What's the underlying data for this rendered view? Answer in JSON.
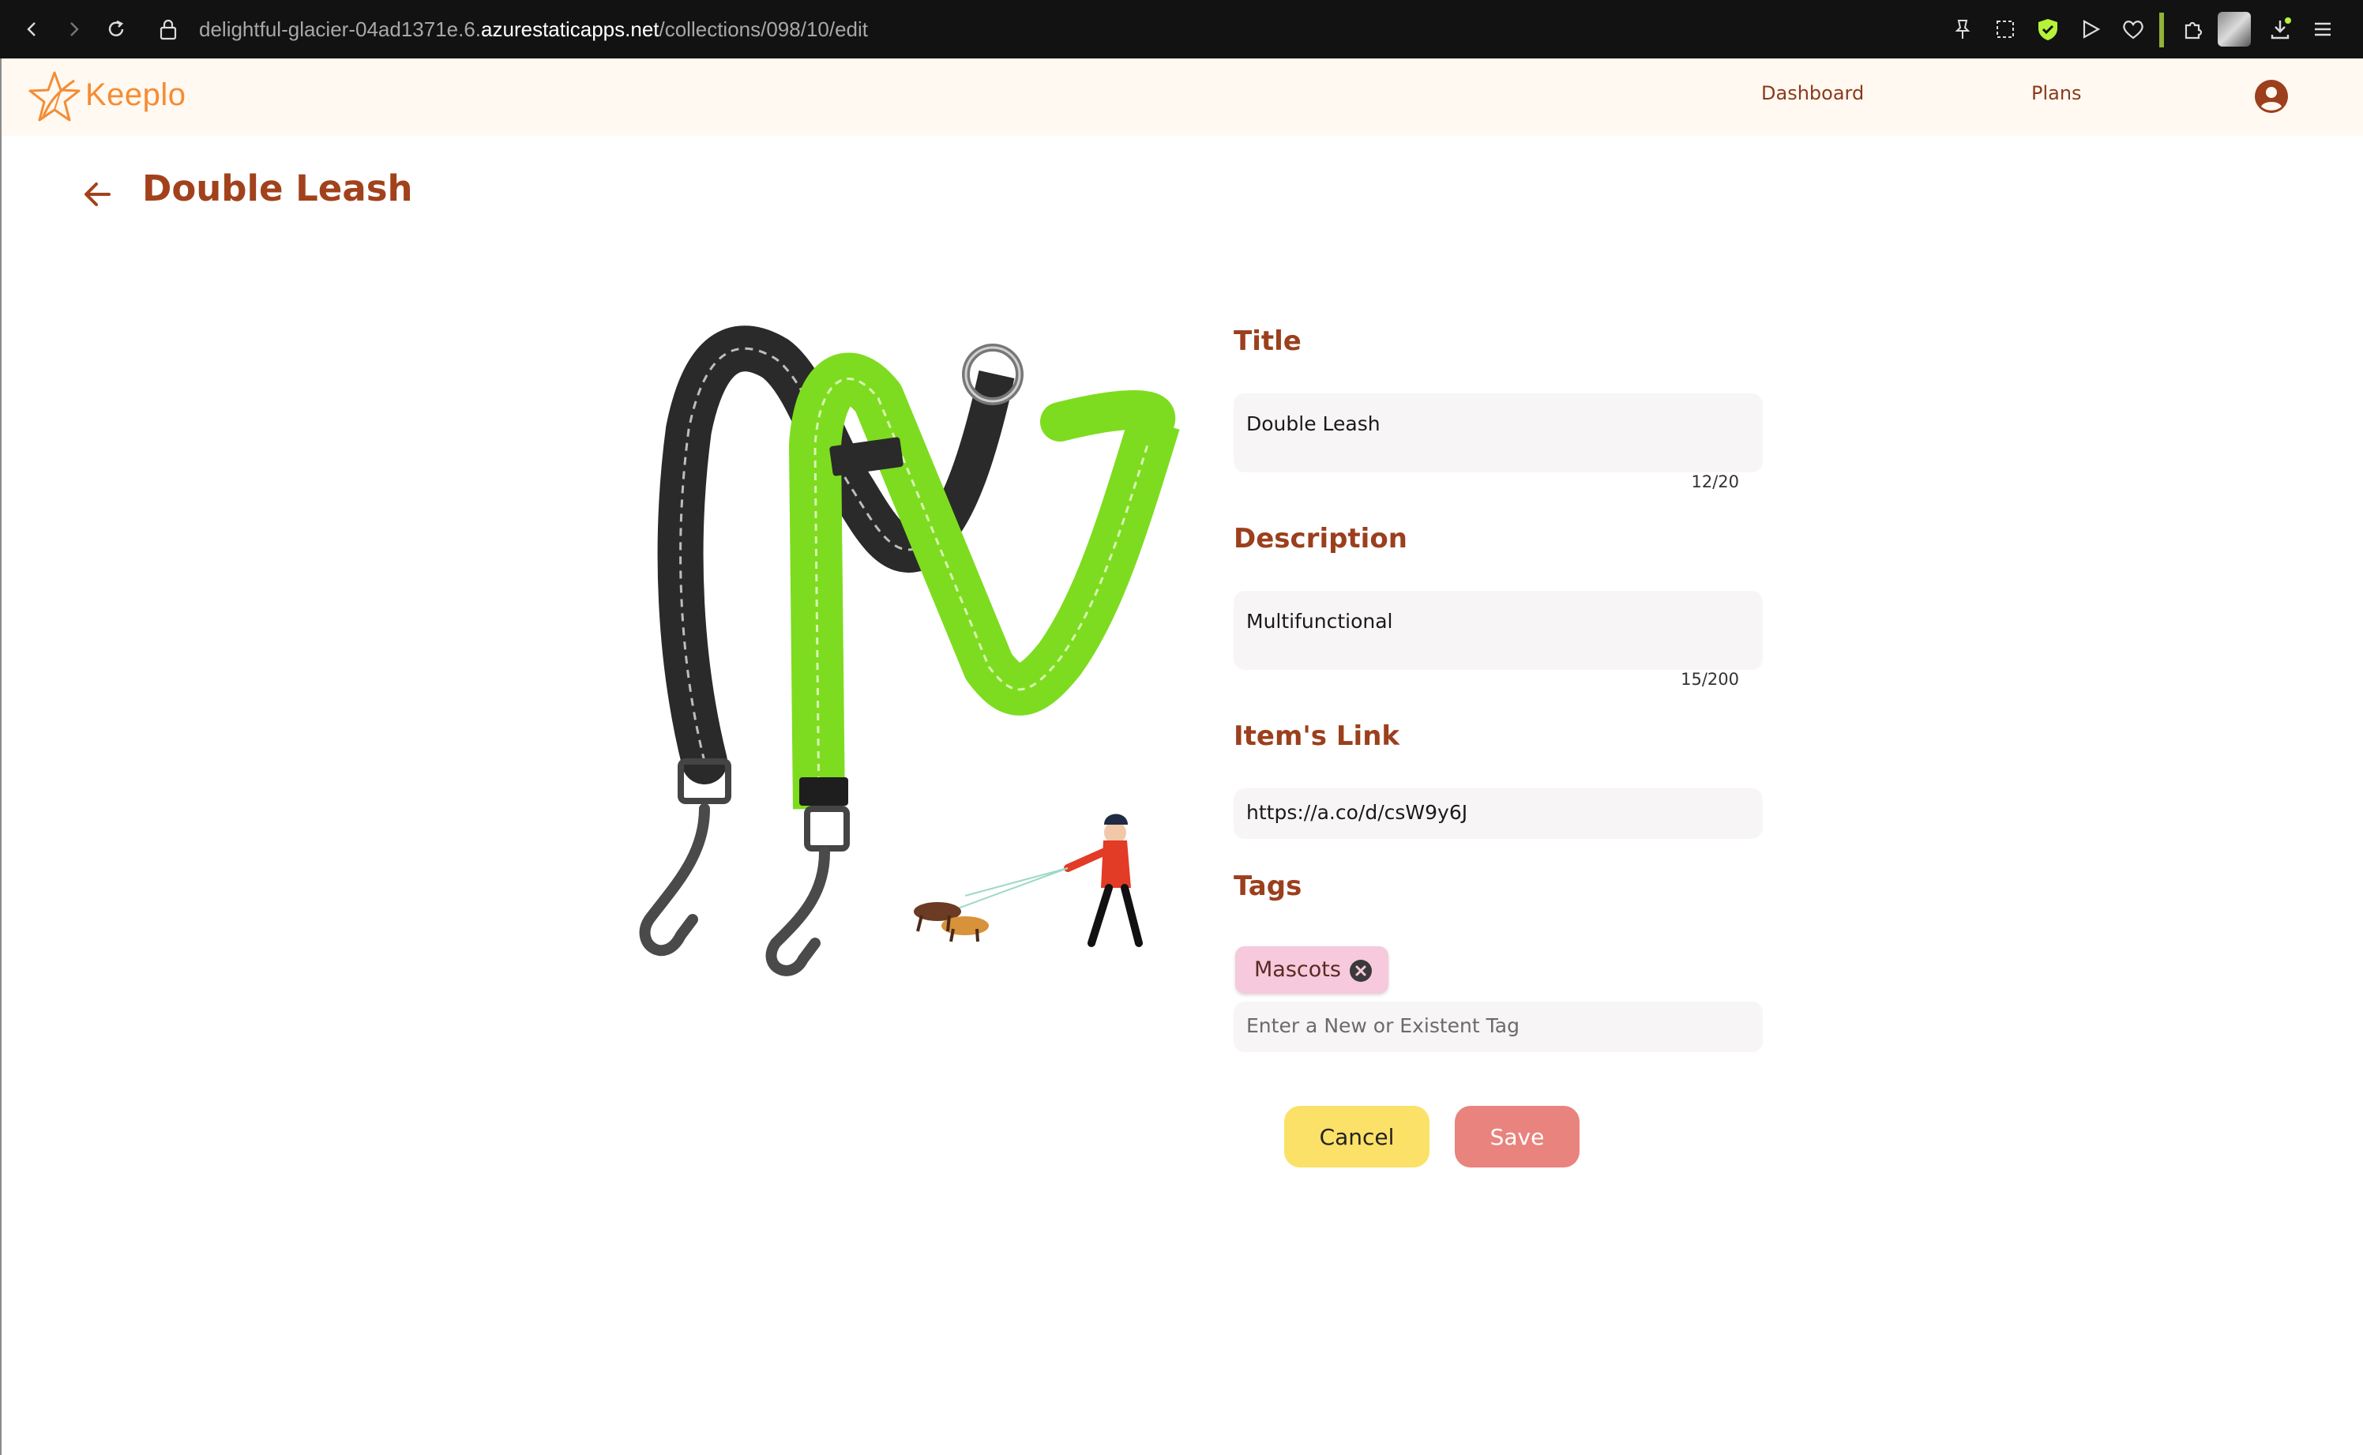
{
  "browser": {
    "url_prefix": "delightful-glacier-04ad1371e.6.",
    "url_host": "azurestaticapps.net",
    "url_path": "/collections/098/10/edit"
  },
  "header": {
    "logo_text": "Keeplo",
    "nav": [
      "Dashboard",
      "Plans"
    ]
  },
  "page": {
    "title": "Double Leash"
  },
  "form": {
    "title_label": "Title",
    "title_value": "Double Leash",
    "title_counter": "12/20",
    "description_label": "Description",
    "description_value": "Multifunctional",
    "description_counter": "15/200",
    "link_label": "Item's Link",
    "link_value": "https://a.co/d/csW9y6J",
    "tags_label": "Tags",
    "tags": [
      "Mascots"
    ],
    "tag_input_placeholder": "Enter a New or Existent Tag"
  },
  "actions": {
    "cancel_label": "Cancel",
    "save_label": "Save"
  },
  "colors": {
    "accent": "#a1421c",
    "header_bg": "#fff9f1",
    "cancel_bg": "#fce168",
    "save_bg": "#e9837d",
    "tag_bg": "#f6c9dc",
    "leash_green": "#7ddc1f",
    "leash_black": "#2a2a2a"
  }
}
